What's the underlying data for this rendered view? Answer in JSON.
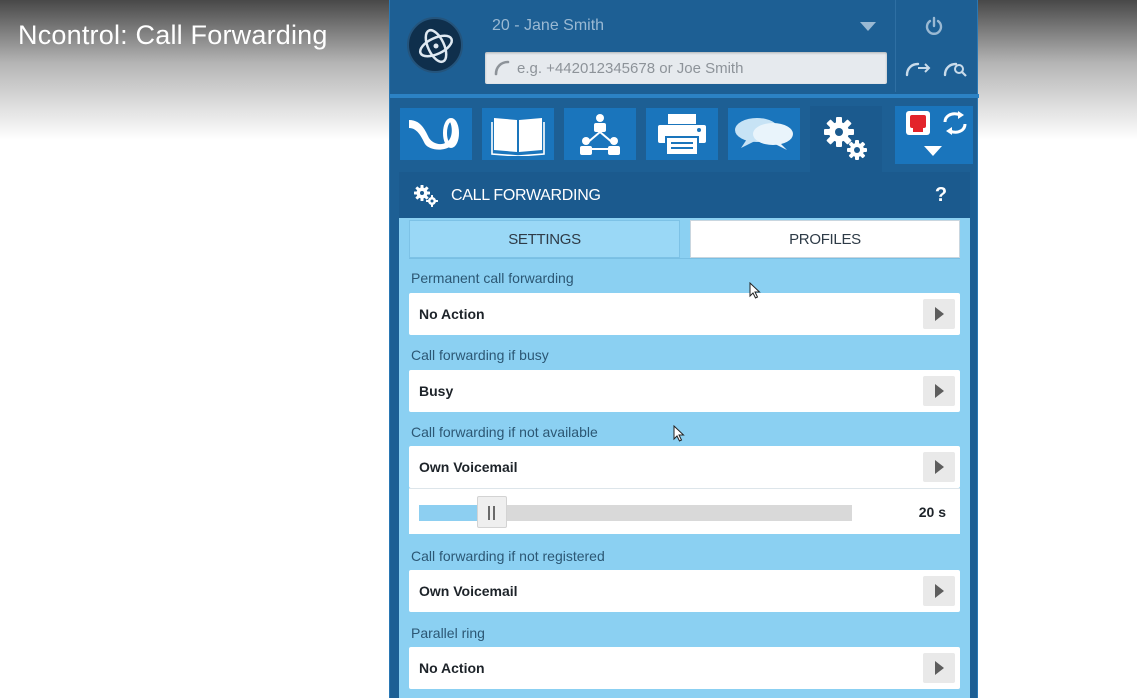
{
  "video": {
    "title": "Ncontrol: Call Forwarding"
  },
  "header": {
    "user_select": "20 - Jane Smith",
    "search_placeholder": "e.g. +442012345678 or Joe Smith"
  },
  "nav": {
    "tiles": [
      {
        "icon": "horn-icon"
      },
      {
        "icon": "phonebook-icon"
      },
      {
        "icon": "network-icon"
      },
      {
        "icon": "fax-icon"
      },
      {
        "icon": "chat-icon"
      },
      {
        "icon": "settings-gears-icon",
        "active": true
      }
    ]
  },
  "panel": {
    "title": "CALL FORWARDING",
    "help": "?",
    "tabs": {
      "settings": "SETTINGS",
      "profiles": "PROFILES",
      "active": "settings"
    },
    "fields": [
      {
        "label": "Permanent call forwarding",
        "value": "No Action"
      },
      {
        "label": "Call forwarding if busy",
        "value": "Busy"
      },
      {
        "label": "Call forwarding if not available",
        "value": "Own Voicemail",
        "timeout_value": "20 s",
        "timeout_fraction": 0.11
      },
      {
        "label": "Call forwarding if not registered",
        "value": "Own Voicemail"
      },
      {
        "label": "Parallel ring",
        "value": "No Action"
      }
    ]
  },
  "colors": {
    "app_bg": "#1d5f94",
    "tile_bg": "#1a75bc",
    "panel_bg": "#8bd0f2",
    "panel_header": "#1b5a8e"
  }
}
